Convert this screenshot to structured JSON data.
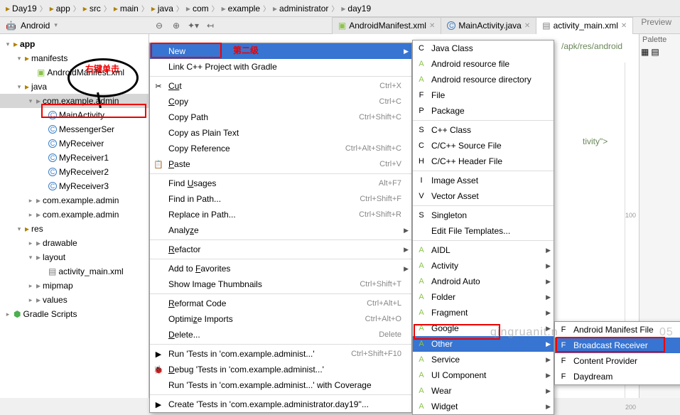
{
  "breadcrumb": [
    "Day19",
    "app",
    "src",
    "main",
    "java",
    "com",
    "example",
    "administrator",
    "day19"
  ],
  "toolbar": {
    "module": "Android"
  },
  "tabs": [
    {
      "label": "AndroidManifest.xml",
      "icon": "android"
    },
    {
      "label": "MainActivity.java",
      "icon": "c"
    },
    {
      "label": "activity_main.xml",
      "icon": "file",
      "active": true
    }
  ],
  "preview_label": "Preview",
  "palette_label": "Palette",
  "tree": {
    "app": "app",
    "manifests": "manifests",
    "manifest_file": "AndroidManifest.xml",
    "java": "java",
    "pkg": "com.example.admin",
    "classes": [
      "MainActivity",
      "MessengerSer",
      "MyReceiver",
      "MyReceiver1",
      "MyReceiver2",
      "MyReceiver3"
    ],
    "pkg2": "com.example.admin",
    "pkg3": "com.example.admin",
    "res": "res",
    "drawable": "drawable",
    "layout": "layout",
    "layout_file": "activity_main.xml",
    "mipmap": "mipmap",
    "values": "values",
    "gradle": "Gradle Scripts"
  },
  "annotations": {
    "right_click": "右键单击",
    "level2": "第二级"
  },
  "context1": [
    {
      "label": "New",
      "hi": true,
      "arrow": true,
      "box": true
    },
    {
      "label": "Link C++ Project with Gradle"
    },
    {
      "sep": true
    },
    {
      "label": "Cut",
      "sc": "Ctrl+X",
      "icon": "✂",
      "u": "Cu"
    },
    {
      "label": "Copy",
      "sc": "Ctrl+C",
      "u": "C"
    },
    {
      "label": "Copy Path",
      "sc": "Ctrl+Shift+C"
    },
    {
      "label": "Copy as Plain Text"
    },
    {
      "label": "Copy Reference",
      "sc": "Ctrl+Alt+Shift+C"
    },
    {
      "label": "Paste",
      "sc": "Ctrl+V",
      "icon": "📋",
      "u": "P"
    },
    {
      "sep": true
    },
    {
      "label": "Find Usages",
      "sc": "Alt+F7",
      "u": "U"
    },
    {
      "label": "Find in Path...",
      "sc": "Ctrl+Shift+F"
    },
    {
      "label": "Replace in Path...",
      "sc": "Ctrl+Shift+R"
    },
    {
      "label": "Analyze",
      "arrow": true,
      "u": "z"
    },
    {
      "sep": true
    },
    {
      "label": "Refactor",
      "arrow": true,
      "u": "R"
    },
    {
      "sep": true
    },
    {
      "label": "Add to Favorites",
      "arrow": true,
      "u": "F"
    },
    {
      "label": "Show Image Thumbnails",
      "sc": "Ctrl+Shift+T"
    },
    {
      "sep": true
    },
    {
      "label": "Reformat Code",
      "sc": "Ctrl+Alt+L",
      "u": "R"
    },
    {
      "label": "Optimize Imports",
      "sc": "Ctrl+Alt+O",
      "u": "z"
    },
    {
      "label": "Delete...",
      "sc": "Delete",
      "u": "D"
    },
    {
      "sep": true
    },
    {
      "label": "Run 'Tests in 'com.example.administ...'",
      "sc": "Ctrl+Shift+F10",
      "icon": "▶"
    },
    {
      "label": "Debug 'Tests in 'com.example.administ...'",
      "icon": "🐞",
      "u": "D"
    },
    {
      "label": "Run 'Tests in 'com.example.administ...' with Coverage"
    },
    {
      "sep": true
    },
    {
      "label": "Create 'Tests in 'com.example.administrator.day19''...",
      "icon": "▶"
    }
  ],
  "context2": [
    {
      "label": "Java Class",
      "icon": "C"
    },
    {
      "label": "Android resource file",
      "icon": "A"
    },
    {
      "label": "Android resource directory",
      "icon": "A"
    },
    {
      "label": "File",
      "icon": "F"
    },
    {
      "label": "Package",
      "icon": "P"
    },
    {
      "sep": true
    },
    {
      "label": "C++ Class",
      "icon": "S"
    },
    {
      "label": "C/C++ Source File",
      "icon": "C"
    },
    {
      "label": "C/C++ Header File",
      "icon": "H"
    },
    {
      "sep": true
    },
    {
      "label": "Image Asset",
      "icon": "I"
    },
    {
      "label": "Vector Asset",
      "icon": "V"
    },
    {
      "sep": true
    },
    {
      "label": "Singleton",
      "icon": "S"
    },
    {
      "label": "Edit File Templates..."
    },
    {
      "sep": true
    },
    {
      "label": "AIDL",
      "arrow": true,
      "icon": "A"
    },
    {
      "label": "Activity",
      "arrow": true,
      "icon": "A"
    },
    {
      "label": "Android Auto",
      "arrow": true,
      "icon": "A"
    },
    {
      "label": "Folder",
      "arrow": true,
      "icon": "A"
    },
    {
      "label": "Fragment",
      "arrow": true,
      "icon": "A"
    },
    {
      "label": "Google",
      "arrow": true,
      "icon": "A"
    },
    {
      "label": "Other",
      "arrow": true,
      "icon": "A",
      "hi": true,
      "box": true
    },
    {
      "label": "Service",
      "arrow": true,
      "icon": "A"
    },
    {
      "label": "UI Component",
      "arrow": true,
      "icon": "A"
    },
    {
      "label": "Wear",
      "arrow": true,
      "icon": "A"
    },
    {
      "label": "Widget",
      "arrow": true,
      "icon": "A"
    }
  ],
  "context3": [
    {
      "label": "Android Manifest File",
      "icon": "F"
    },
    {
      "label": "Broadcast Receiver",
      "icon": "F",
      "hi": true,
      "box": true
    },
    {
      "label": "Content Provider",
      "icon": "F"
    },
    {
      "label": "Daydream",
      "icon": "F"
    }
  ],
  "editor_text": {
    "line1": "/apk/res/android",
    "line2": "tivity\">"
  },
  "watermark": "qingruanit.n",
  "ruler": {
    "v1": "100",
    "v2": "200"
  },
  "timestamp_fragment": "05"
}
